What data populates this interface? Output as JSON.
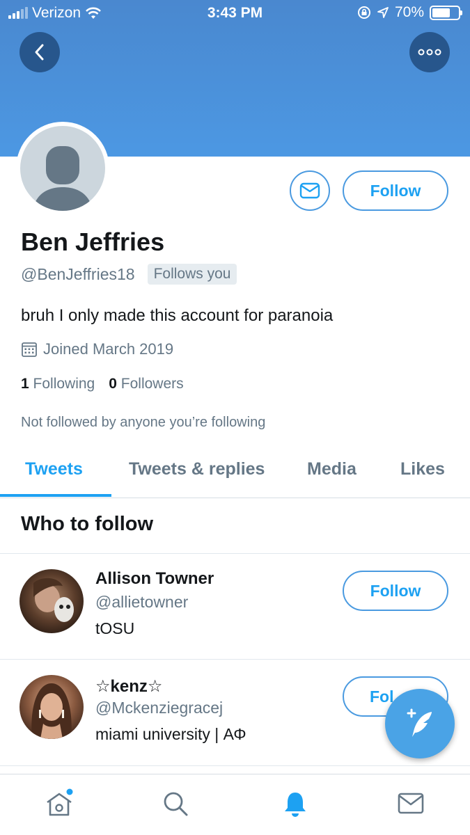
{
  "status_bar": {
    "carrier": "Verizon",
    "time": "3:43 PM",
    "battery": "70%",
    "battery_level": 0.7
  },
  "header": {
    "back_icon": "chevron-left-icon",
    "more_icon": "more-dots-icon",
    "color": "#4c98e3"
  },
  "profile": {
    "name": "Ben Jeffries",
    "handle": "@BenJeffries18",
    "follows_you": "Follows you",
    "bio": "bruh I only made this account for paranoia",
    "joined": "Joined March 2019",
    "following_count": "1",
    "following_label": "Following",
    "followers_count": "0",
    "followers_label": "Followers",
    "not_followed": "Not followed by anyone you’re following",
    "follow_label": "Follow",
    "message_icon": "mail-icon"
  },
  "tabs": [
    {
      "label": "Tweets",
      "active": true
    },
    {
      "label": "Tweets & replies",
      "active": false
    },
    {
      "label": "Media",
      "active": false
    },
    {
      "label": "Likes",
      "active": false
    }
  ],
  "who_to_follow": {
    "title": "Who to follow",
    "users": [
      {
        "name": "Allison Towner",
        "handle": "@allietowner",
        "bio": "tOSU",
        "follow_label": "Follow"
      },
      {
        "name": "☆kenz☆",
        "handle": "@Mckenziegracej",
        "bio": "miami university | ΑΦ",
        "follow_label": "Fol"
      }
    ]
  },
  "fab_icon": "compose-tweet-icon",
  "tab_bar": {
    "items": [
      "home-icon",
      "search-icon",
      "notifications-bell-icon",
      "messages-icon"
    ],
    "active": "notifications-bell-icon",
    "accent": "#1da1f2"
  }
}
